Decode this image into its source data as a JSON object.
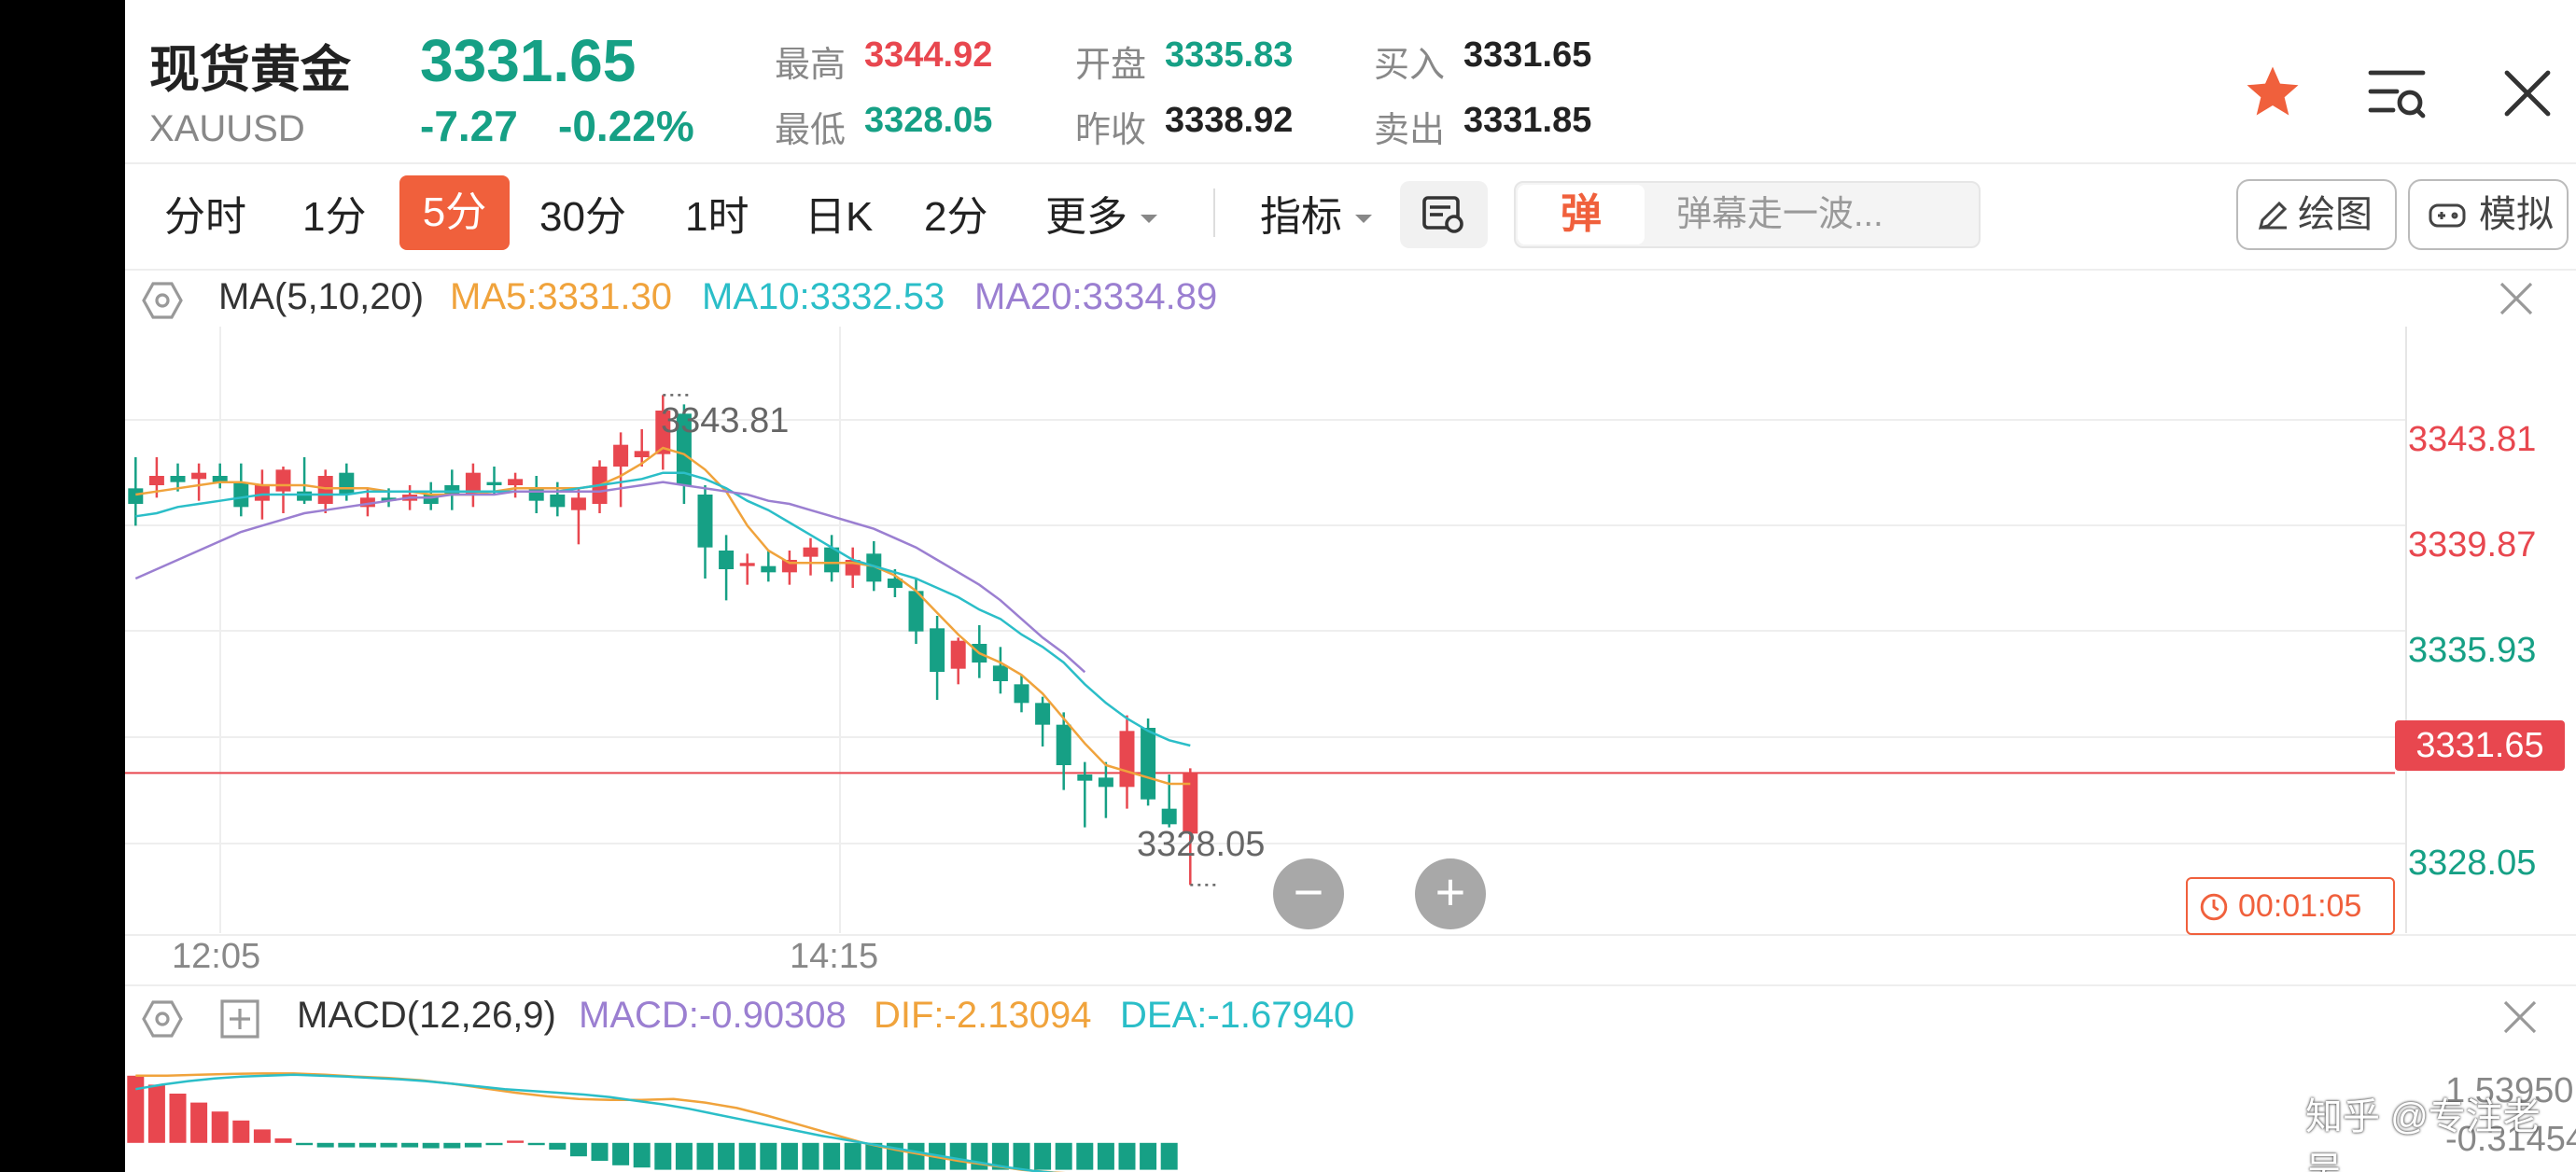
{
  "header": {
    "title": "现货黄金",
    "code": "XAUUSD",
    "price": "3331.65",
    "change": "-7.27",
    "change_pct": "-0.22%",
    "stats": {
      "high_label": "最高",
      "high": "3344.92",
      "low_label": "最低",
      "low": "3328.05",
      "open_label": "开盘",
      "open": "3335.83",
      "prev_close_label": "昨收",
      "prev_close": "3338.92",
      "bid_label": "买入",
      "bid": "3331.65",
      "ask_label": "卖出",
      "ask": "3331.85"
    },
    "icons": [
      "star-icon",
      "list-settings-icon",
      "close-icon"
    ]
  },
  "periods": {
    "tabs": [
      "分时",
      "1分",
      "5分",
      "30分",
      "1时",
      "日K",
      "2分",
      "更多"
    ],
    "active": "5分",
    "indicator_label": "指标",
    "danmu_badge": "弹",
    "danmu_placeholder": "弹幕走一波...",
    "draw_label": "绘图",
    "sim_label": "模拟"
  },
  "ma_legend": {
    "name": "MA(5,10,20)",
    "ma5": "MA5:3331.30",
    "ma10": "MA10:3332.53",
    "ma20": "MA20:3334.89"
  },
  "macd_legend": {
    "name": "MACD(12,26,9)",
    "macd": "MACD:-0.90308",
    "dif": "DIF:-2.13094",
    "dea": "DEA:-1.67940",
    "axis_top": "1.53950",
    "axis_bottom": "-0.31454"
  },
  "chart": {
    "price_axis": [
      "3343.81",
      "3339.87",
      "3335.93",
      "3328.05"
    ],
    "current_price_tag": "3331.65",
    "high_marker": "3343.81",
    "low_marker": "3328.05",
    "time_labels": [
      "12:05",
      "14:15"
    ],
    "countdown": "00:01:05",
    "zoom_out": "−",
    "zoom_in": "+"
  },
  "chart_data": {
    "type": "candlestick",
    "y_range": [
      3326.5,
      3346.0
    ],
    "candles": [
      [
        3340.8,
        3341.8,
        3339.6,
        3340.3
      ],
      [
        3340.9,
        3341.8,
        3340.5,
        3341.2
      ],
      [
        3341.2,
        3341.6,
        3340.7,
        3341.0
      ],
      [
        3341.1,
        3341.6,
        3340.4,
        3341.3
      ],
      [
        3341.2,
        3341.6,
        3340.8,
        3341.0
      ],
      [
        3341.0,
        3341.6,
        3339.9,
        3340.2
      ],
      [
        3340.4,
        3341.4,
        3339.8,
        3340.9
      ],
      [
        3340.7,
        3341.5,
        3340.0,
        3341.4
      ],
      [
        3340.7,
        3341.8,
        3340.3,
        3340.4
      ],
      [
        3340.3,
        3341.4,
        3340.0,
        3341.2
      ],
      [
        3341.3,
        3341.6,
        3340.4,
        3340.6
      ],
      [
        3340.2,
        3340.8,
        3339.9,
        3340.5
      ],
      [
        3340.5,
        3340.8,
        3340.2,
        3340.4
      ],
      [
        3340.4,
        3340.9,
        3340.1,
        3340.6
      ],
      [
        3340.6,
        3341.0,
        3340.1,
        3340.3
      ],
      [
        3340.9,
        3341.4,
        3340.1,
        3340.6
      ],
      [
        3340.6,
        3341.6,
        3340.2,
        3341.3
      ],
      [
        3341.0,
        3341.5,
        3340.6,
        3340.9
      ],
      [
        3340.9,
        3341.3,
        3340.5,
        3341.1
      ],
      [
        3340.8,
        3341.2,
        3340.0,
        3340.4
      ],
      [
        3340.6,
        3341.0,
        3339.9,
        3340.2
      ],
      [
        3340.1,
        3340.8,
        3339.0,
        3340.5
      ],
      [
        3340.3,
        3341.7,
        3340.0,
        3341.5
      ],
      [
        3341.5,
        3342.6,
        3340.2,
        3342.2
      ],
      [
        3341.8,
        3342.7,
        3341.5,
        3342.0
      ],
      [
        3341.9,
        3343.8,
        3341.4,
        3343.3
      ],
      [
        3343.2,
        3343.5,
        3340.3,
        3340.9
      ],
      [
        3340.6,
        3340.9,
        3337.9,
        3338.9
      ],
      [
        3338.8,
        3339.3,
        3337.2,
        3338.2
      ],
      [
        3338.3,
        3338.7,
        3337.7,
        3338.4
      ],
      [
        3338.3,
        3338.8,
        3337.8,
        3338.1
      ],
      [
        3338.1,
        3338.8,
        3337.7,
        3338.5
      ],
      [
        3338.6,
        3339.2,
        3338.0,
        3338.9
      ],
      [
        3338.9,
        3339.3,
        3337.8,
        3338.1
      ],
      [
        3338.0,
        3338.9,
        3337.6,
        3338.5
      ],
      [
        3338.7,
        3339.1,
        3337.5,
        3337.8
      ],
      [
        3337.9,
        3338.2,
        3337.3,
        3337.6
      ],
      [
        3337.5,
        3337.9,
        3335.8,
        3336.2
      ],
      [
        3336.3,
        3336.7,
        3334.0,
        3334.9
      ],
      [
        3335.0,
        3336.0,
        3334.5,
        3335.9
      ],
      [
        3335.8,
        3336.4,
        3334.7,
        3335.2
      ],
      [
        3335.1,
        3335.7,
        3334.2,
        3334.6
      ],
      [
        3334.5,
        3334.8,
        3333.6,
        3333.9
      ],
      [
        3333.9,
        3334.1,
        3332.5,
        3333.2
      ],
      [
        3333.2,
        3333.6,
        3331.1,
        3331.9
      ],
      [
        3331.6,
        3332.0,
        3329.9,
        3331.4
      ],
      [
        3331.5,
        3332.0,
        3330.2,
        3331.2
      ],
      [
        3331.2,
        3333.5,
        3330.5,
        3333.0
      ],
      [
        3333.1,
        3333.4,
        3330.6,
        3330.8
      ],
      [
        3330.5,
        3331.6,
        3329.9,
        3330.0
      ],
      [
        3329.7,
        3331.8,
        3328.05,
        3331.65
      ]
    ],
    "ma5": [
      3340.6,
      3340.7,
      3340.8,
      3340.9,
      3341.0,
      3341.0,
      3340.9,
      3340.9,
      3340.9,
      3340.8,
      3340.8,
      3340.8,
      3340.7,
      3340.7,
      3340.6,
      3340.6,
      3340.6,
      3340.7,
      3340.8,
      3340.8,
      3340.8,
      3340.8,
      3340.9,
      3341.2,
      3341.6,
      3342.1,
      3341.9,
      3341.4,
      3340.7,
      3339.6,
      3338.8,
      3338.4,
      3338.4,
      3338.4,
      3338.4,
      3338.3,
      3338.0,
      3337.5,
      3336.8,
      3336.1,
      3335.5,
      3335.2,
      3334.8,
      3334.2,
      3333.4,
      3332.6,
      3331.9,
      3331.7,
      3331.5,
      3331.3,
      3331.3
    ],
    "ma10": [
      3339.9,
      3340.0,
      3340.2,
      3340.3,
      3340.4,
      3340.5,
      3340.6,
      3340.6,
      3340.6,
      3340.6,
      3340.6,
      3340.7,
      3340.7,
      3340.7,
      3340.7,
      3340.7,
      3340.7,
      3340.7,
      3340.7,
      3340.7,
      3340.7,
      3340.8,
      3340.9,
      3341.0,
      3341.1,
      3341.3,
      3341.3,
      3341.1,
      3340.8,
      3340.4,
      3340.1,
      3339.7,
      3339.3,
      3338.9,
      3338.5,
      3338.3,
      3338.1,
      3337.9,
      3337.6,
      3337.3,
      3336.9,
      3336.6,
      3336.1,
      3335.7,
      3335.2,
      3334.5,
      3333.9,
      3333.4,
      3333.0,
      3332.7,
      3332.53
    ],
    "ma20_start": 0,
    "ma20": [
      3337.9,
      3338.2,
      3338.5,
      3338.8,
      3339.1,
      3339.4,
      3339.6,
      3339.8,
      3340.0,
      3340.1,
      3340.2,
      3340.3,
      3340.4,
      3340.5,
      3340.5,
      3340.6,
      3340.6,
      3340.6,
      3340.7,
      3340.7,
      3340.7,
      3340.7,
      3340.7,
      3340.8,
      3340.9,
      3341.0,
      3340.9,
      3340.8,
      3340.7,
      3340.6,
      3340.4,
      3340.3,
      3340.1,
      3339.9,
      3339.7,
      3339.5,
      3339.2,
      3338.9,
      3338.5,
      3338.1,
      3337.7,
      3337.2,
      3336.6,
      3336.0,
      3335.5,
      3334.89
    ],
    "macd_hist": [
      1.5,
      1.3,
      1.1,
      0.9,
      0.7,
      0.5,
      0.3,
      0.1,
      -0.05,
      -0.1,
      -0.1,
      -0.1,
      -0.1,
      -0.1,
      -0.12,
      -0.12,
      -0.1,
      -0.05,
      0.05,
      -0.05,
      -0.15,
      -0.3,
      -0.4,
      -0.5,
      -0.55,
      -0.6,
      -0.6,
      -0.6,
      -0.6,
      -0.6,
      -0.6,
      -0.6,
      -0.6,
      -0.6,
      -0.6,
      -0.6,
      -0.6,
      -0.6,
      -0.6,
      -0.6,
      -0.6,
      -0.6,
      -0.6,
      -0.6,
      -0.6,
      -0.6,
      -0.6,
      -0.6,
      -0.6,
      -0.6
    ],
    "macd_range": [
      -0.65,
      1.6
    ],
    "dif_line": [
      1.5,
      1.5,
      1.52,
      1.54,
      1.55,
      1.55,
      1.52,
      1.48,
      1.45,
      1.4,
      1.32,
      1.22,
      1.12,
      1.04,
      0.98,
      0.96,
      0.96,
      0.98,
      0.9,
      0.78,
      0.6,
      0.4,
      0.2,
      0.0,
      -0.15,
      -0.28,
      -0.4,
      -0.5,
      -0.6,
      -0.66,
      -0.7,
      -0.72,
      -0.74,
      -0.76
    ],
    "dea_line": [
      1.2,
      1.3,
      1.38,
      1.44,
      1.48,
      1.5,
      1.52,
      1.5,
      1.48,
      1.45,
      1.42,
      1.38,
      1.32,
      1.26,
      1.2,
      1.16,
      1.12,
      1.08,
      1.02,
      0.94,
      0.86,
      0.76,
      0.64,
      0.52,
      0.4,
      0.28,
      0.16,
      0.06,
      -0.04,
      -0.14,
      -0.24,
      -0.34,
      -0.44,
      -0.54,
      -0.62,
      -0.68,
      -0.72,
      -0.76,
      -0.78,
      -0.8
    ],
    "colors": {
      "up": "#e8474f",
      "down": "#16a085",
      "ma5": "#f0a33c",
      "ma10": "#2bbec8",
      "ma20": "#9b7fd1",
      "price_line": "#e8474f"
    }
  },
  "watermark": "知乎 @专注老吴"
}
